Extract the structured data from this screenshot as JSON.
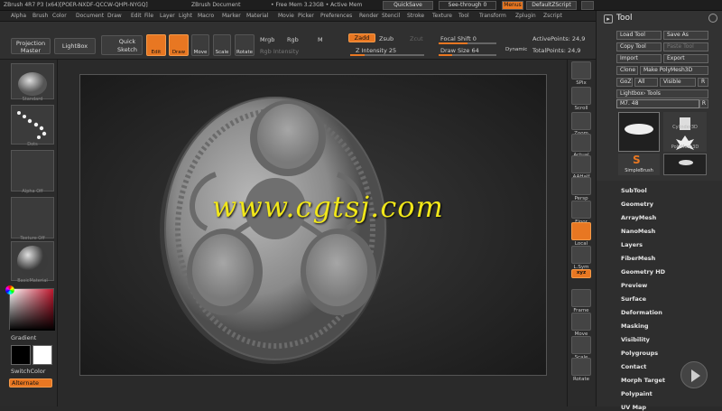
{
  "window": {
    "title": "ZBrush 4R7 P3 (x64)[POER-NXDF-QCCW-QHPI-NYGQ]",
    "document": "ZBrush Document",
    "mem": "• Free Mem 3.23GB • Active Mem",
    "quicksave": "QuickSave",
    "seethrough": "See-through  0",
    "menus": "Menus",
    "script": "DefaultZScript"
  },
  "menu": [
    "Alpha",
    "Brush",
    "Color",
    "Document",
    "Draw",
    "Edit",
    "File",
    "Layer",
    "Light",
    "Macro",
    "Marker",
    "Material",
    "Movie",
    "Picker",
    "Preferences",
    "Render",
    "Stencil",
    "Stroke",
    "Texture",
    "Tool",
    "Transform",
    "Zplugin",
    "Zscript"
  ],
  "shelf": {
    "projection_master": "Projection Master",
    "lightbox": "LightBox",
    "quick_sketch": "Quick Sketch",
    "edit": "Edit",
    "draw": "Draw",
    "move": "Move",
    "scale": "Scale",
    "rotate": "Rotate",
    "mrgb": "Mrgb",
    "rgb": "Rgb",
    "m": "M",
    "rgb_intensity": "Rgb Intensity",
    "zadd": "Zadd",
    "zsub": "Zsub",
    "zcut": "Zcut",
    "z_intensity": "Z Intensity 25",
    "focal_shift": "Focal Shift 0",
    "draw_size": "Draw Size 64",
    "dynamic": "Dynamic",
    "active_points": "ActivePoints: 24,9",
    "total_points": "TotalPoints: 24,9",
    "z_intensity_value": 25,
    "draw_size_value": 64,
    "focal_shift_value": 0
  },
  "left": {
    "brush": "Standard",
    "stroke": "Dots",
    "alpha": "Alpha Off",
    "texture": "Texture Off",
    "material": "BasicMaterial",
    "gradient": "Gradient",
    "switch_color": "SwitchColor",
    "alternate": "Alternate"
  },
  "right": [
    "SPix",
    "Scroll",
    "Zoom",
    "Actual",
    "AAHalf",
    "Persp",
    "Floor",
    "Local",
    "L.Sym",
    "xyz",
    "Frame",
    "Move",
    "Scale",
    "Rotate"
  ],
  "tool": {
    "header": "Tool",
    "load": "Load Tool",
    "save_as": "Save As",
    "copy": "Copy Tool",
    "paste": "Paste Tool",
    "import": "Import",
    "export": "Export",
    "clone": "Clone",
    "make_polymesh": "Make PolyMesh3D",
    "goz": "GoZ",
    "all": "All",
    "visible": "Visible",
    "r": "R",
    "lightbox_tools": "Lightbox› Tools",
    "current": "M7. 48",
    "thumb_cyl": "Cylinder3D",
    "thumb_poly": "PolyMesh3D",
    "thumb_simple": "SimpleBrush",
    "thumb_m7": "M7",
    "items": [
      "SubTool",
      "Geometry",
      "ArrayMesh",
      "NanoMesh",
      "Layers",
      "FiberMesh",
      "Geometry HD",
      "Preview",
      "Surface",
      "Deformation",
      "Masking",
      "Visibility",
      "Polygroups",
      "Contact",
      "Morph Target",
      "Polypaint",
      "UV Map"
    ]
  },
  "watermark": "www.cgtsj.com",
  "colors": {
    "accent": "#e87722",
    "watermark": "#f0e61a"
  }
}
